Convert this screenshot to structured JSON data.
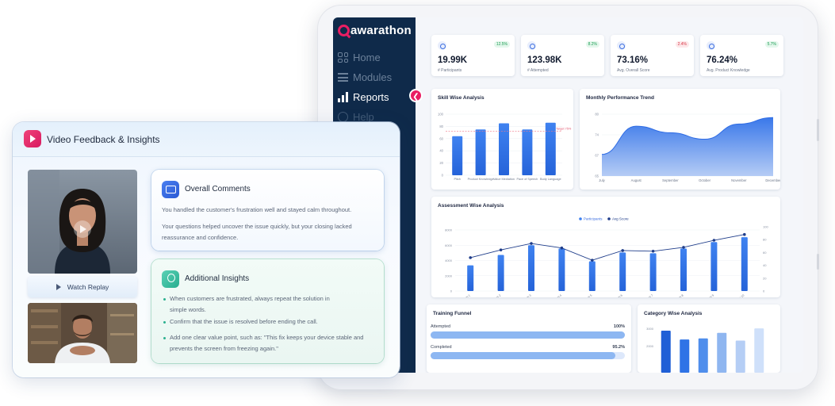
{
  "brand": {
    "name": "awarathon",
    "accent": "#e91e63",
    "sidebar_color": "#0f2a4a"
  },
  "sidebar": {
    "items": [
      {
        "label": "Home",
        "icon": "home-grid-icon"
      },
      {
        "label": "Modules",
        "icon": "list-icon"
      },
      {
        "label": "Reports",
        "icon": "bar-chart-icon"
      },
      {
        "label": "Help",
        "icon": "help-icon"
      }
    ],
    "active": "Reports"
  },
  "stats": [
    {
      "value": "19.99K",
      "label": "# Participants",
      "delta": "12.5%",
      "trend": "up"
    },
    {
      "value": "123.98K",
      "label": "# Attempted",
      "delta": "8.2%",
      "trend": "up"
    },
    {
      "value": "73.16%",
      "label": "Avg. Overall Score",
      "delta": "2.4%",
      "trend": "down"
    },
    {
      "value": "76.24%",
      "label": "Avg. Product Knowledge",
      "delta": "5.7%",
      "trend": "up"
    }
  ],
  "skill_chart": {
    "title": "Skill Wise Analysis",
    "target_label": "Target 75%"
  },
  "monthly_chart": {
    "title": "Monthly Performance Trend"
  },
  "assessment_chart": {
    "title": "Assessment Wise Analysis"
  },
  "funnel": {
    "title": "Training Funnel",
    "rows": [
      {
        "label": "Attempted",
        "value": "100%",
        "fraction": 1.0
      },
      {
        "label": "Completed",
        "value": "95.2%",
        "fraction": 0.952
      }
    ]
  },
  "category_chart": {
    "title": "Category Wise Analysis"
  },
  "chart_data": [
    {
      "type": "bar",
      "title": "Skill Wise Analysis",
      "categories": [
        "Pitch",
        "Product Knowledge",
        "Value Mediation",
        "Pace of Speech",
        "Body Language"
      ],
      "values": [
        64,
        75,
        85,
        75,
        86
      ],
      "ylim": [
        0,
        100
      ],
      "yticks": [
        "100",
        "80",
        "60",
        "40",
        "20",
        "0"
      ],
      "target": 72
    },
    {
      "type": "area",
      "title": "Monthly Performance Trend",
      "categories": [
        "July",
        "August",
        "September",
        "October",
        "November",
        "December"
      ],
      "values": [
        70,
        76.5,
        75,
        73.5,
        77,
        78.5
      ],
      "ylim": [
        65,
        80
      ],
      "yticks": [
        "80",
        "74",
        "67",
        "65"
      ]
    },
    {
      "type": "bar",
      "title": "Assessment Wise Analysis",
      "categories": [
        "Assm 1",
        "Assm 2",
        "Assm 3",
        "Assm 4",
        "Assm 5",
        "Assm 6",
        "Assm 7",
        "Assm 8",
        "Assm 9",
        "Assm 10"
      ],
      "series": [
        {
          "name": "Participants",
          "values": [
            3200,
            4500,
            5700,
            5300,
            3700,
            4800,
            4700,
            5300,
            6100,
            6700
          ]
        },
        {
          "name": "Avg Score",
          "values": [
            52,
            64,
            74,
            67,
            48,
            63,
            62,
            68,
            79,
            88
          ]
        }
      ],
      "y_left_ticks": [
        "8000",
        "6000",
        "4000",
        "2000",
        "0"
      ],
      "y_right_ticks": [
        "100",
        "80",
        "60",
        "40",
        "20",
        "0"
      ],
      "ylim": [
        0,
        8000
      ],
      "y2lim": [
        0,
        100
      ]
    },
    {
      "type": "bar",
      "title": "Category Wise Analysis",
      "categories": [
        "C1",
        "C2",
        "C3",
        "C4",
        "C5",
        "C6"
      ],
      "values": [
        3800,
        3000,
        3100,
        3600,
        2900,
        4000
      ],
      "yticks": [
        "3000",
        "2000"
      ]
    }
  ],
  "feedback_panel": {
    "title": "Video Feedback & Insights",
    "watch_replay": "Watch Replay",
    "overall": {
      "title": "Overall Comments",
      "paragraphs": [
        "You handled the customer's frustration well and stayed calm throughout.",
        "Your questions helped uncover the issue quickly, but your closing lacked reassurance and confidence."
      ]
    },
    "insights": {
      "title": "Additional Insights",
      "bullets": [
        "When customers are frustrated, always repeat the solution in simple words.",
        "Confirm that the issue is resolved before ending the call.",
        "Add one clear value point, such as: \"This fix keeps your device stable and prevents the screen from freezing again.\""
      ]
    }
  }
}
